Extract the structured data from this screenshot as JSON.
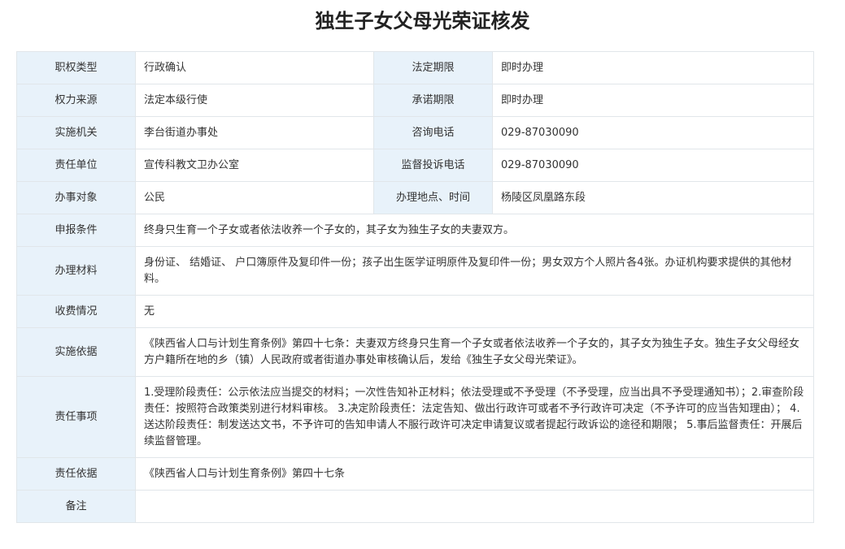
{
  "page_title": "独生子女父母光荣证核发",
  "rows_pair": [
    {
      "label1": "职权类型",
      "value1": "行政确认",
      "label2": "法定期限",
      "value2": "即时办理"
    },
    {
      "label1": "权力来源",
      "value1": "法定本级行使",
      "label2": "承诺期限",
      "value2": "即时办理"
    },
    {
      "label1": "实施机关",
      "value1": "李台街道办事处",
      "label2": "咨询电话",
      "value2": "029-87030090"
    },
    {
      "label1": "责任单位",
      "value1": "宣传科教文卫办公室",
      "label2": "监督投诉电话",
      "value2": "029-87030090"
    },
    {
      "label1": "办事对象",
      "value1": "公民",
      "label2": "办理地点、时间",
      "value2": "杨陵区凤凰路东段"
    }
  ],
  "rows_full": [
    {
      "label": "申报条件",
      "value": "终身只生育一个子女或者依法收养一个子女的，其子女为独生子女的夫妻双方。"
    },
    {
      "label": "办理材料",
      "value": "身份证、 结婚证、 户口簿原件及复印件一份；孩子出生医学证明原件及复印件一份；男女双方个人照片各4张。办证机构要求提供的其他材料。"
    },
    {
      "label": "收费情况",
      "value": "无"
    },
    {
      "label": "实施依据",
      "value": "《陕西省人口与计划生育条例》第四十七条：夫妻双方终身只生育一个子女或者依法收养一个子女的，其子女为独生子女。独生子女父母经女方户籍所在地的乡（镇）人民政府或者街道办事处审核确认后，发给《独生子女父母光荣证》。"
    },
    {
      "label": "责任事项",
      "value": "1.受理阶段责任：公示依法应当提交的材料；一次性告知补正材料；依法受理或不予受理（不予受理，应当出具不予受理通知书）；2.审查阶段责任：按照符合政策类别进行材料审核。 3.决定阶段责任：法定告知、做出行政许可或者不予行政许可决定（不予许可的应当告知理由）； 4.送达阶段责任：制发送达文书，不予许可的告知申请人不服行政许可决定申请复议或者提起行政诉讼的途径和期限； 5.事后监督责任：开展后续监督管理。"
    },
    {
      "label": "责任依据",
      "value": "《陕西省人口与计划生育条例》第四十七条"
    },
    {
      "label": "备注",
      "value": ""
    }
  ]
}
